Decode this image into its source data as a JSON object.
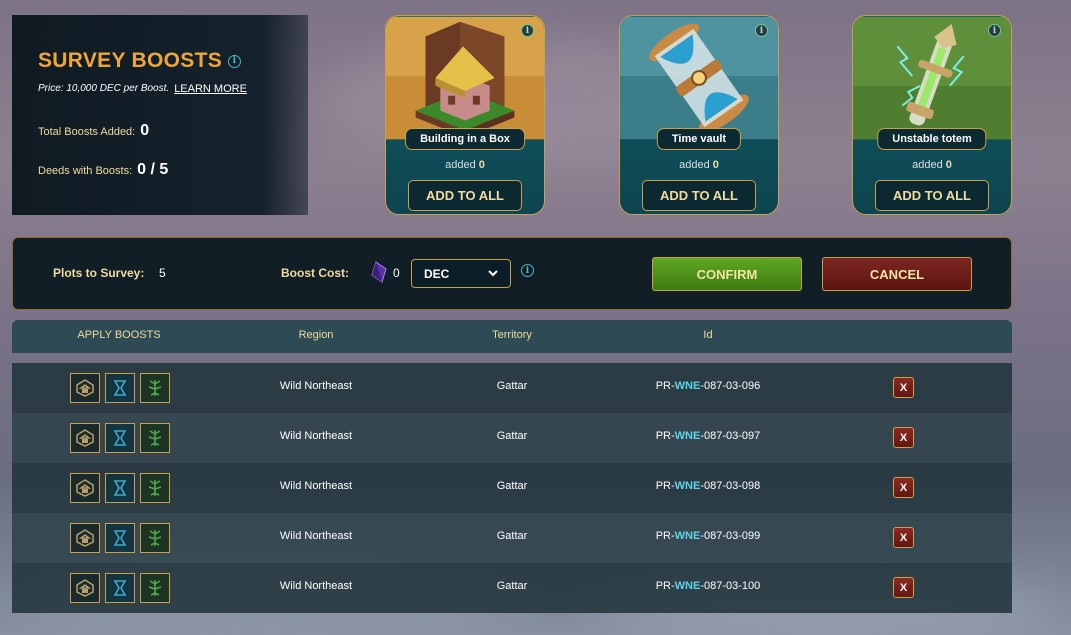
{
  "header": {
    "title": "SURVEY BOOSTS",
    "price_text": "Price: 10,000 DEC per Boost.",
    "learn_more": "LEARN MORE",
    "total_boosts_label": "Total Boosts Added:",
    "total_boosts_value": "0",
    "deeds_label": "Deeds with Boosts:",
    "deeds_value": "0 / 5"
  },
  "boosts": [
    {
      "name": "Building in a Box",
      "added_label": "added",
      "added_value": "0",
      "button": "ADD TO ALL",
      "icon": "building-box-icon"
    },
    {
      "name": "Time vault",
      "added_label": "added",
      "added_value": "0",
      "button": "ADD TO ALL",
      "icon": "time-vault-icon"
    },
    {
      "name": "Unstable totem",
      "added_label": "added",
      "added_value": "0",
      "button": "ADD TO ALL",
      "icon": "unstable-totem-icon"
    }
  ],
  "controls": {
    "plots_label": "Plots to Survey:",
    "plots_value": "5",
    "cost_label": "Boost Cost:",
    "cost_value": "0",
    "currency_selected": "DEC",
    "confirm": "CONFIRM",
    "cancel": "CANCEL"
  },
  "table": {
    "headers": [
      "APPLY BOOSTS",
      "Region",
      "Territory",
      "Id"
    ],
    "rows": [
      {
        "region": "Wild Northeast",
        "territory": "Gattar",
        "id_prefix": "PR-",
        "id_mid": "WNE",
        "id_suffix": "-087-03-096",
        "remove": "X"
      },
      {
        "region": "Wild Northeast",
        "territory": "Gattar",
        "id_prefix": "PR-",
        "id_mid": "WNE",
        "id_suffix": "-087-03-097",
        "remove": "X"
      },
      {
        "region": "Wild Northeast",
        "territory": "Gattar",
        "id_prefix": "PR-",
        "id_mid": "WNE",
        "id_suffix": "-087-03-098",
        "remove": "X"
      },
      {
        "region": "Wild Northeast",
        "territory": "Gattar",
        "id_prefix": "PR-",
        "id_mid": "WNE",
        "id_suffix": "-087-03-099",
        "remove": "X"
      },
      {
        "region": "Wild Northeast",
        "territory": "Gattar",
        "id_prefix": "PR-",
        "id_mid": "WNE",
        "id_suffix": "-087-03-100",
        "remove": "X"
      }
    ]
  },
  "colors": {
    "accent_gold": "#f0a53a",
    "border_gold": "#c9a14a",
    "confirm_green": "#4f9119",
    "cancel_red": "#6e1e19",
    "id_cyan": "#5ed4ea"
  }
}
